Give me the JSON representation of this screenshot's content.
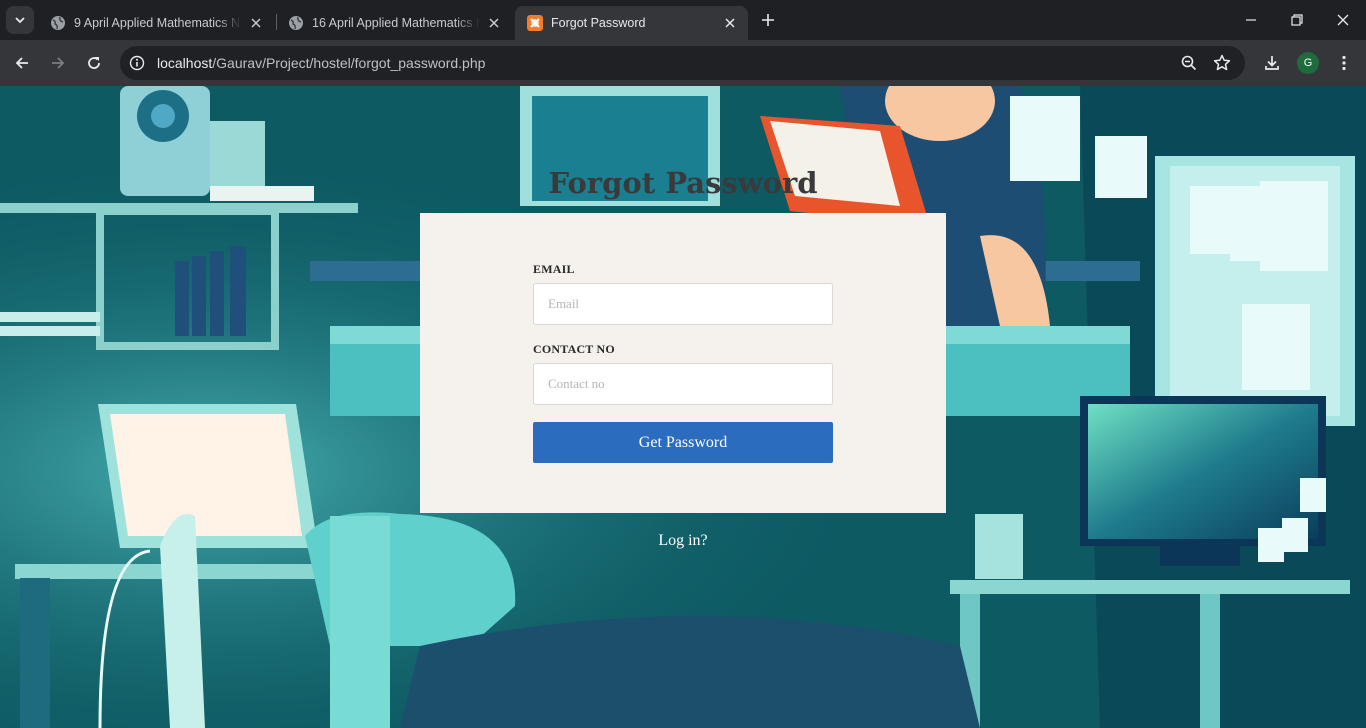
{
  "browser": {
    "tabs": [
      {
        "title": "9 April Applied Mathematics N",
        "icon": "globe-icon",
        "active": false
      },
      {
        "title": "16 April Applied Mathematics N",
        "icon": "globe-icon",
        "active": false
      },
      {
        "title": "Forgot Password",
        "icon": "xampp-icon",
        "active": true
      }
    ],
    "url_host": "localhost",
    "url_path": "/Gaurav/Project/hostel/forgot_password.php",
    "profile_initial": "G"
  },
  "form": {
    "title": "Forgot Password",
    "email_label": "EMAIL",
    "email_placeholder": "Email",
    "contact_label": "CONTACT NO",
    "contact_placeholder": "Contact no",
    "submit_label": "Get Password",
    "login_link": "Log in?"
  },
  "colors": {
    "accent_button": "#2b6cbf",
    "card_background": "#f5f1ec",
    "page_background": "#0e5d66"
  }
}
